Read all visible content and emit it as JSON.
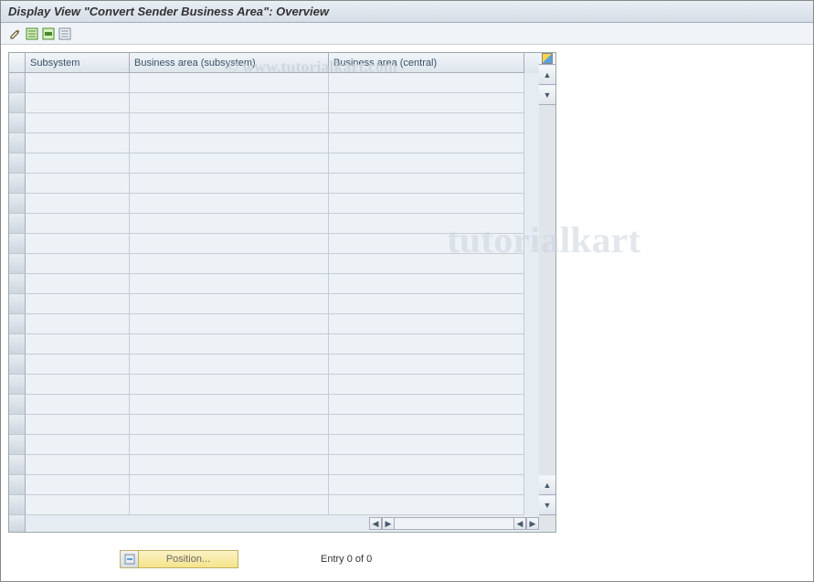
{
  "title": "Display View \"Convert Sender Business Area\": Overview",
  "watermark1": "© www.tutorialkart.com",
  "watermark2": "tutorialkart",
  "table": {
    "columns": {
      "subsystem": "Subsystem",
      "ba_subsystem": "Business area (subsystem)",
      "ba_central": "Business area (central)"
    },
    "row_count": 22
  },
  "footer": {
    "position_label": "Position...",
    "entry_text": "Entry 0 of 0"
  }
}
